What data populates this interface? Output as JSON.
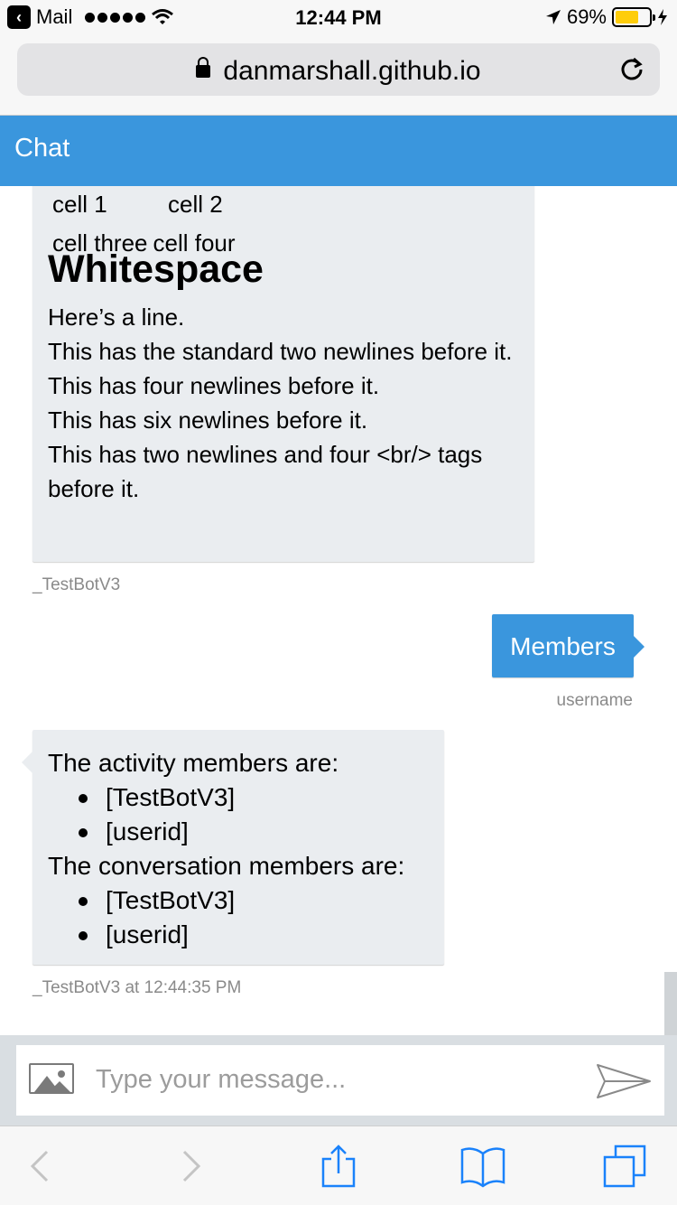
{
  "status_bar": {
    "back_app": "Mail",
    "time": "12:44 PM",
    "battery_percent": "69%",
    "battery_level": 0.69,
    "battery_color": "#fecd0a"
  },
  "browser": {
    "url": "danmarshall.github.io"
  },
  "chat": {
    "header_title": "Chat",
    "accent_color": "#3a96dd",
    "bubble_bg": "#eaedf0"
  },
  "messages": {
    "bot_message_1": {
      "table_rows": [
        [
          "cell 1",
          "cell 2"
        ],
        [
          "cell three",
          "cell four"
        ]
      ],
      "heading": "Whitespace",
      "lines": [
        "Here’s a line.",
        "This has the standard two newlines before it.",
        "This has four newlines before it.",
        "This has six newlines before it.",
        "This has two newlines and four <br/> tags before it."
      ],
      "sender": "_TestBotV3"
    },
    "user_message": {
      "text": "Members",
      "sender": "username"
    },
    "bot_message_2": {
      "activity_heading": "The activity members are:",
      "activity_members": [
        "[TestBotV3]",
        "[userid]"
      ],
      "conversation_heading": "The conversation members are:",
      "conversation_members": [
        "[TestBotV3]",
        "[userid]"
      ],
      "meta": "_TestBotV3 at 12:44:35 PM"
    }
  },
  "composer": {
    "placeholder": "Type your message...",
    "upload_icon": "image-icon",
    "send_icon": "send-icon"
  },
  "safari_toolbar": {
    "icons": [
      "back-icon",
      "forward-icon",
      "share-icon",
      "bookmarks-icon",
      "tabs-icon"
    ]
  }
}
